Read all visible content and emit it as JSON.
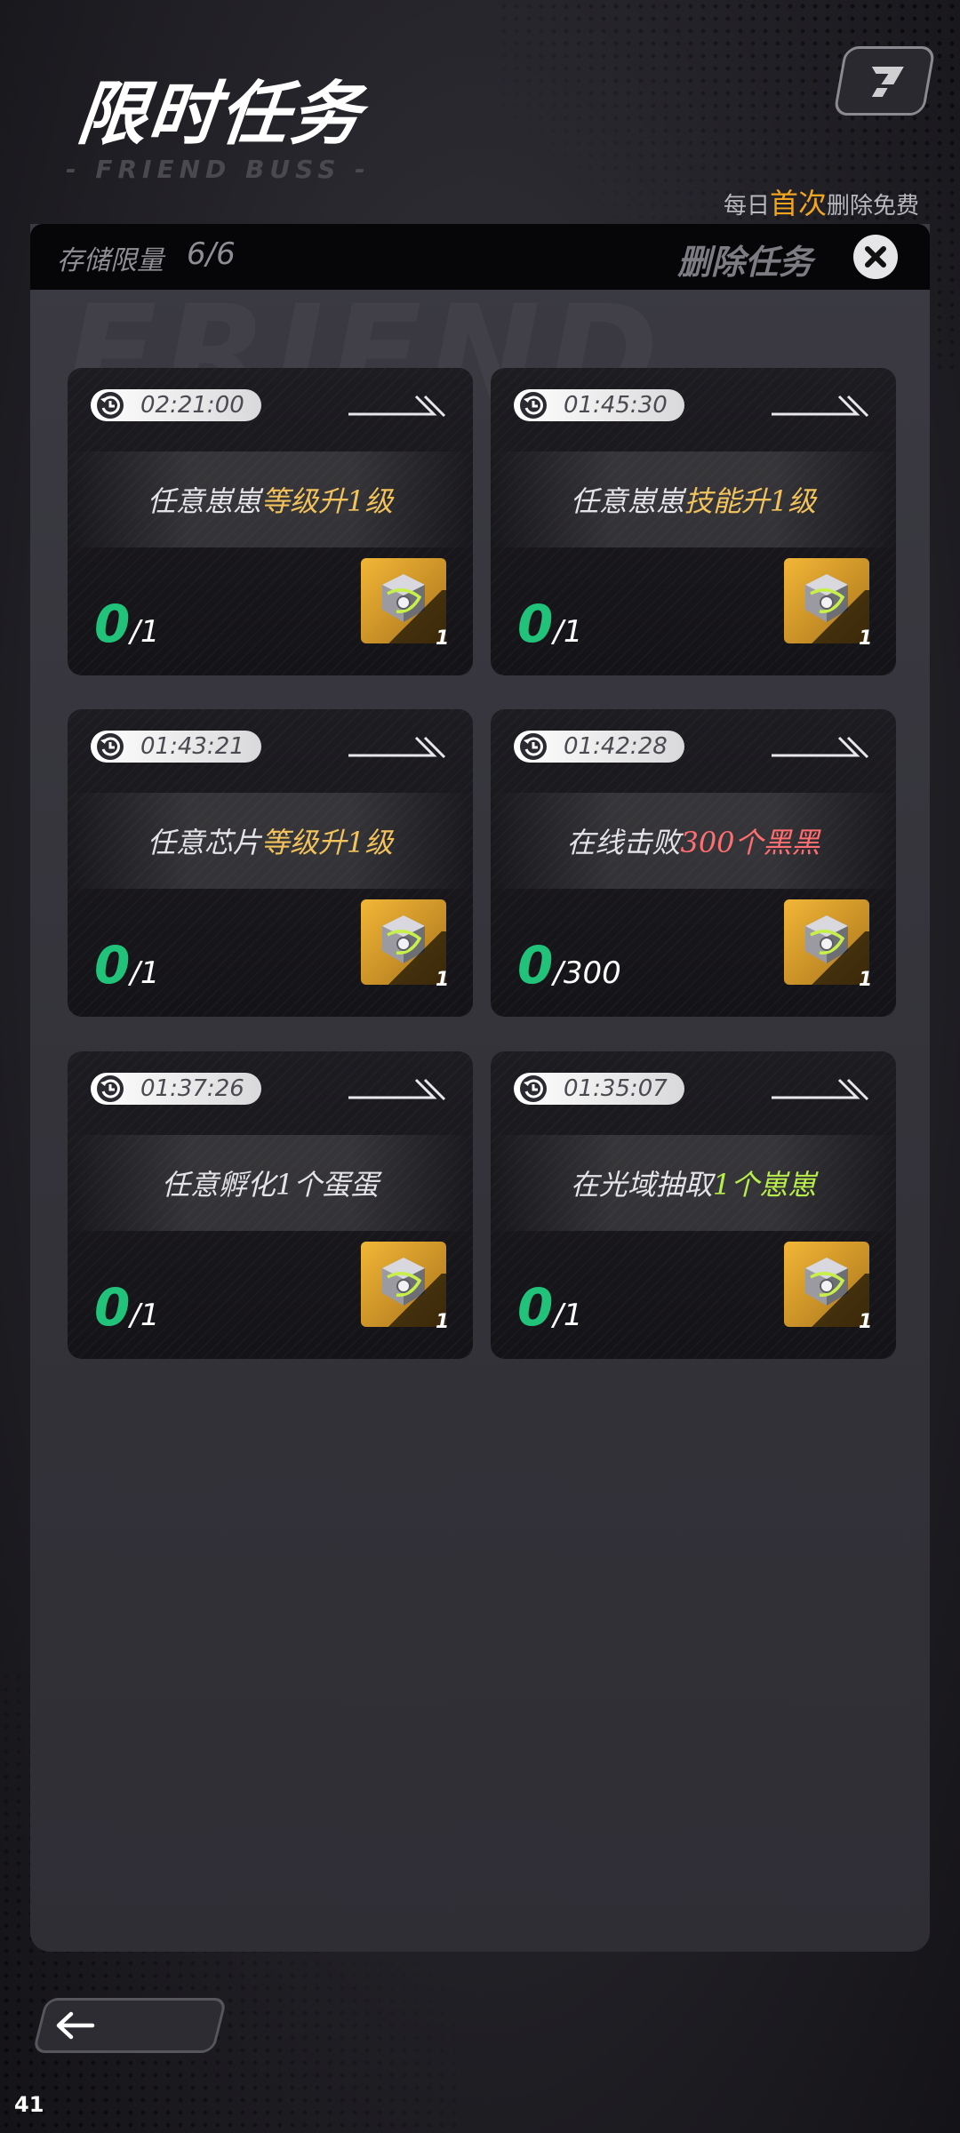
{
  "header": {
    "title": "限时任务",
    "subtitle": "- FRIEND BUSS -",
    "free_delete": {
      "pre": "每日",
      "highlight": "首次",
      "post": "删除免费"
    }
  },
  "panel": {
    "storage_label": "存储限量",
    "storage_value": "6/6",
    "delete_task_label": "删除任务"
  },
  "tasks": [
    {
      "timer": "02:21:00",
      "desc_pre": "任意崽崽",
      "desc_hl": "等级升1级",
      "hl_color": "gold",
      "progress_current": "0",
      "progress_total": "/1",
      "reward_count": "1"
    },
    {
      "timer": "01:45:30",
      "desc_pre": "任意崽崽",
      "desc_hl": "技能升1级",
      "hl_color": "gold",
      "progress_current": "0",
      "progress_total": "/1",
      "reward_count": "1"
    },
    {
      "timer": "01:43:21",
      "desc_pre": "任意芯片",
      "desc_hl": "等级升1级",
      "hl_color": "gold",
      "progress_current": "0",
      "progress_total": "/1",
      "reward_count": "1"
    },
    {
      "timer": "01:42:28",
      "desc_pre": "在线击败",
      "desc_hl": "300个黑黑",
      "hl_color": "red",
      "progress_current": "0",
      "progress_total": "/300",
      "reward_count": "1"
    },
    {
      "timer": "01:37:26",
      "desc_pre": "任意孵化1个蛋蛋",
      "desc_hl": "",
      "hl_color": "gold",
      "progress_current": "0",
      "progress_total": "/1",
      "reward_count": "1"
    },
    {
      "timer": "01:35:07",
      "desc_pre": "在光域抽取",
      "desc_hl": "1个崽崽",
      "hl_color": "green",
      "progress_current": "0",
      "progress_total": "/1",
      "reward_count": "1"
    }
  ],
  "footer": {
    "number": "41"
  }
}
